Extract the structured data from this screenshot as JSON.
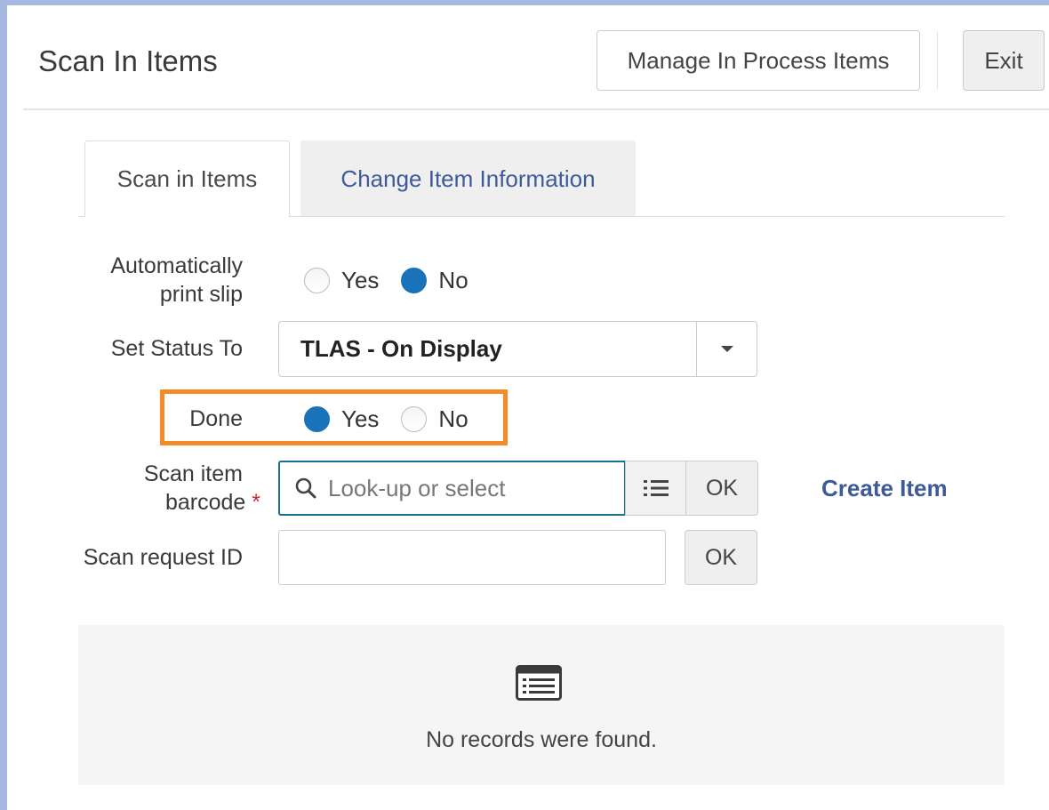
{
  "header": {
    "title": "Scan In Items",
    "manage_label": "Manage In Process Items",
    "exit_label": "Exit"
  },
  "tabs": [
    {
      "label": "Scan in Items",
      "active": true
    },
    {
      "label": "Change Item Information",
      "active": false
    }
  ],
  "form": {
    "auto_print": {
      "label_line1": "Automatically",
      "label_line2": "print slip",
      "options": [
        {
          "label": "Yes",
          "checked": false
        },
        {
          "label": "No",
          "checked": true
        }
      ]
    },
    "status": {
      "label": "Set Status To",
      "value": "TLAS - On Display"
    },
    "done": {
      "label": "Done",
      "options": [
        {
          "label": "Yes",
          "checked": true
        },
        {
          "label": "No",
          "checked": false
        }
      ]
    },
    "barcode": {
      "label_line1": "Scan item",
      "label_line2": "barcode",
      "required_mark": "*",
      "placeholder": "Look-up or select",
      "value": "",
      "ok_label": "OK",
      "create_label": "Create Item"
    },
    "request": {
      "label": "Scan request ID",
      "value": "",
      "ok_label": "OK"
    }
  },
  "results": {
    "empty_text": "No records were found."
  },
  "colors": {
    "accent_blue": "#1a73b8",
    "link_blue": "#3f5a99",
    "highlight_orange": "#f28c28",
    "frame_border": "#a7b9e0",
    "required_red": "#d0272e"
  },
  "icons": {
    "search": "search-icon",
    "list": "list-icon",
    "records": "records-list-icon",
    "caret": "chevron-down-icon"
  }
}
